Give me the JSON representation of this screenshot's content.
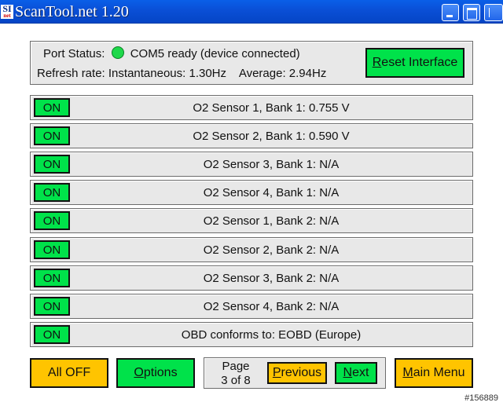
{
  "window": {
    "title": "ScanTool.net 1.20",
    "logo_text": "SI",
    "logo_sub": "net"
  },
  "status": {
    "port_label": "Port Status:",
    "port_value": "COM5 ready (device connected)",
    "port_indicator_color": "#1ed84a",
    "refresh_label": "Refresh rate:",
    "instantaneous_label": "Instantaneous:",
    "instantaneous_value": "1.30Hz",
    "average_label": "Average:",
    "average_value": "2.94Hz",
    "reset_button": {
      "first": "R",
      "rest": "eset Interface"
    }
  },
  "rows": [
    {
      "button": "ON",
      "label": "O2 Sensor 1, Bank 1:",
      "value": "0.755 V"
    },
    {
      "button": "ON",
      "label": "O2 Sensor 2, Bank 1:",
      "value": "0.590 V"
    },
    {
      "button": "ON",
      "label": "O2 Sensor 3, Bank 1:",
      "value": "N/A"
    },
    {
      "button": "ON",
      "label": "O2 Sensor 4, Bank 1:",
      "value": "N/A"
    },
    {
      "button": "ON",
      "label": "O2 Sensor 1, Bank 2:",
      "value": "N/A"
    },
    {
      "button": "ON",
      "label": "O2 Sensor 2, Bank 2:",
      "value": "N/A"
    },
    {
      "button": "ON",
      "label": "O2 Sensor 3, Bank 2:",
      "value": "N/A"
    },
    {
      "button": "ON",
      "label": "O2 Sensor 4, Bank 2:",
      "value": "N/A"
    },
    {
      "button": "ON",
      "label": "OBD conforms to:",
      "value": "EOBD (Europe)"
    }
  ],
  "bottom": {
    "all_off": "All OFF",
    "options": {
      "first": "O",
      "rest": "ptions"
    },
    "page_label": "Page",
    "page_of": "3 of 8",
    "previous": {
      "first": "P",
      "rest": "revious"
    },
    "next": {
      "first": "N",
      "rest": "ext"
    },
    "main_menu": {
      "first": "M",
      "rest": "ain Menu"
    }
  },
  "colors": {
    "on_button": "#00e24a",
    "amber_button": "#ffc400",
    "titlebar": "#0a4fd6"
  },
  "watermark": "#156889"
}
